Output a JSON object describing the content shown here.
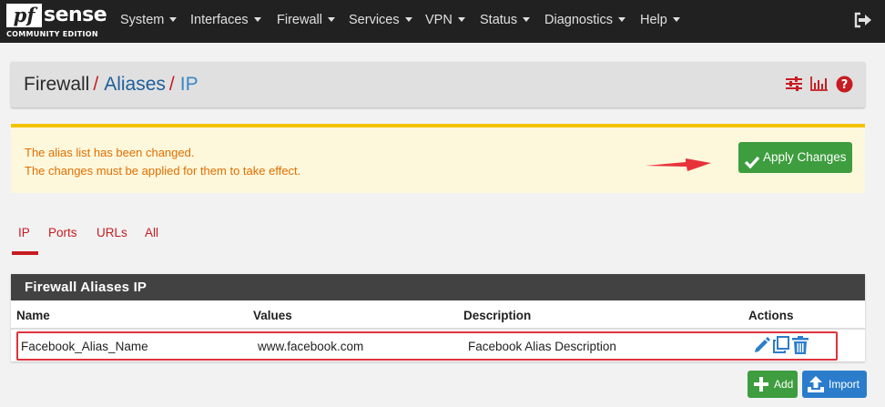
{
  "brand": {
    "logo_pf": "pf",
    "logo_sense": "sense",
    "edition": "COMMUNITY EDITION"
  },
  "nav": {
    "items": [
      {
        "label": "System"
      },
      {
        "label": "Interfaces"
      },
      {
        "label": "Firewall"
      },
      {
        "label": "Services"
      },
      {
        "label": "VPN"
      },
      {
        "label": "Status"
      },
      {
        "label": "Diagnostics"
      },
      {
        "label": "Help"
      }
    ],
    "logout_icon": "sign-out-icon"
  },
  "breadcrumb": {
    "root": "Firewall",
    "separator": "/",
    "parent": "Aliases",
    "current": "IP",
    "icons": [
      "sliders-icon",
      "bar-chart-icon",
      "question-circle-icon"
    ]
  },
  "alert": {
    "line1": "The alias list has been changed.",
    "line2": "The changes must be applied for them to take effect.",
    "apply_label": "Apply Changes"
  },
  "tabs": [
    {
      "label": "IP",
      "active": true
    },
    {
      "label": "Ports",
      "active": false
    },
    {
      "label": "URLs",
      "active": false
    },
    {
      "label": "All",
      "active": false
    }
  ],
  "table": {
    "title": "Firewall Aliases IP",
    "columns": [
      "Name",
      "Values",
      "Description",
      "Actions"
    ],
    "rows": [
      {
        "name": "Facebook_Alias_Name",
        "values": "www.facebook.com",
        "description": "Facebook Alias Description"
      }
    ],
    "action_icons": [
      "pencil-icon",
      "copy-icon",
      "trash-icon"
    ]
  },
  "buttons": {
    "add_label": "Add",
    "import_label": "Import"
  },
  "colors": {
    "navbar": "#212121",
    "accent_red": "#c71c22",
    "link_blue": "#1d5e9c",
    "alert_text": "#e26e00",
    "alert_bg": "#fdf8dc",
    "success": "#3e9d3e",
    "primary": "#2b7dcc",
    "highlight": "#e0323c"
  }
}
